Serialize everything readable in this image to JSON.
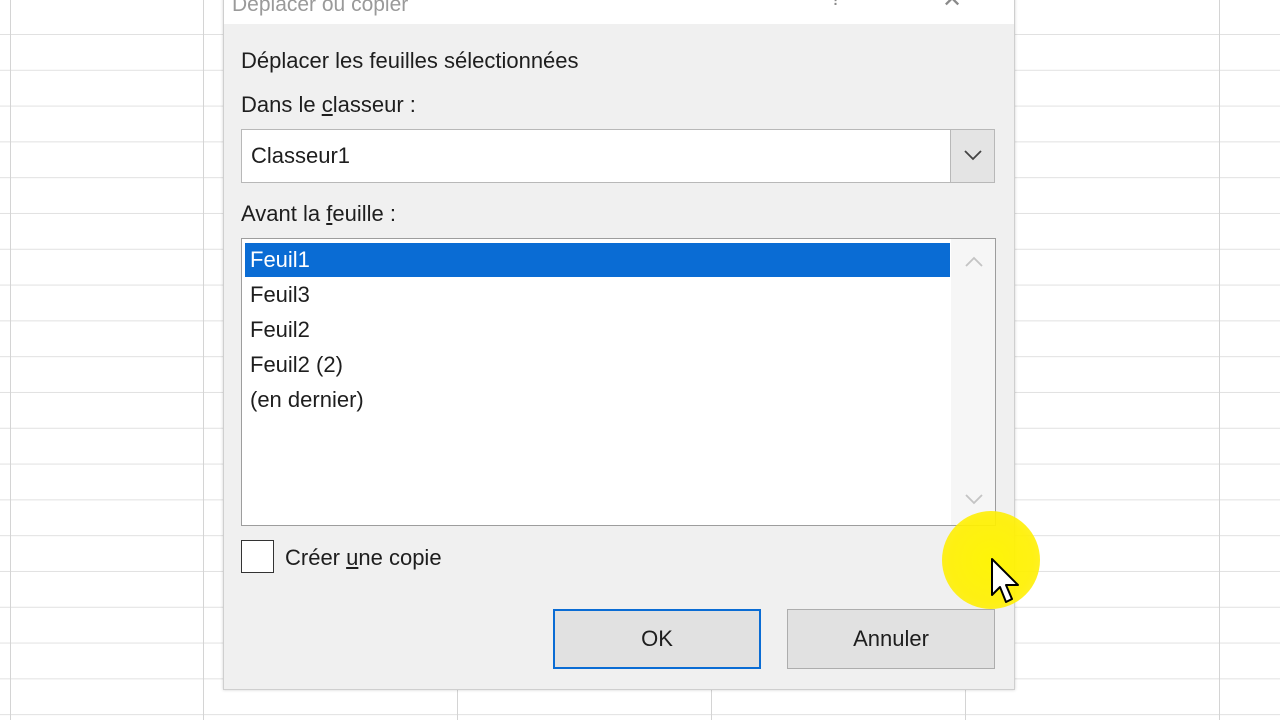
{
  "dialog": {
    "title": "Déplacer ou copier",
    "help_glyph": "?",
    "close_glyph": "✕",
    "heading": "Déplacer les feuilles sélectionnées",
    "workbook_label_pre": "Dans le ",
    "workbook_label_accel": "c",
    "workbook_label_post": "lasseur :",
    "workbook_value": "Classeur1",
    "before_label_pre": "Avant la ",
    "before_label_accel": "f",
    "before_label_post": "euille :",
    "sheets": [
      "Feuil1",
      "Feuil3",
      "Feuil2",
      "Feuil2 (2)",
      "(en dernier)"
    ],
    "selected_sheet": "Feuil1",
    "copy_label_pre": "Créer ",
    "copy_label_accel": "u",
    "copy_label_post": "ne copie",
    "copy_checked": false,
    "ok_label": "OK",
    "cancel_label": "Annuler"
  },
  "colors": {
    "selection": "#0a6cd4",
    "cursor_highlight": "#fff200"
  },
  "icons": {
    "combo_arrow": "chevron-down-icon",
    "scroll_up": "chevron-up-icon",
    "scroll_down": "chevron-down-icon",
    "close": "close-icon",
    "pointer": "mouse-pointer-icon"
  }
}
